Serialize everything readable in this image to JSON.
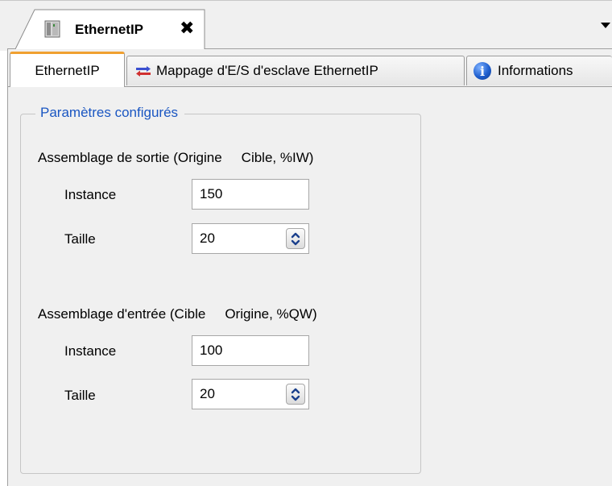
{
  "document_tab": {
    "title": "EthernetIP",
    "close_glyph": "✖",
    "icon": "device-module-icon"
  },
  "strip_menu_icon": "dropdown-arrow-icon",
  "tabs": [
    {
      "label": "EthernetIP",
      "active": true
    },
    {
      "label": "Mappage d'E/S d'esclave EthernetIP",
      "icon": "io-mapping-icon",
      "active": false
    },
    {
      "label": "Informations",
      "icon": "info-icon",
      "active": false
    }
  ],
  "group": {
    "title": "Paramètres configurés",
    "output_assembly": {
      "label_part1": "Assemblage de sortie (Origine",
      "label_part2": "Cible, %IW)",
      "instance_label": "Instance",
      "instance_value": "150",
      "size_label": "Taille",
      "size_value": "20"
    },
    "input_assembly": {
      "label_part1": "Assemblage d'entrée (Cible",
      "label_part2": "Origine, %QW)",
      "instance_label": "Instance",
      "instance_value": "100",
      "size_label": "Taille",
      "size_value": "20"
    }
  },
  "colors": {
    "accent_tab": "#f0a030",
    "group_title": "#1a56c2",
    "background": "#f0f0f0"
  }
}
